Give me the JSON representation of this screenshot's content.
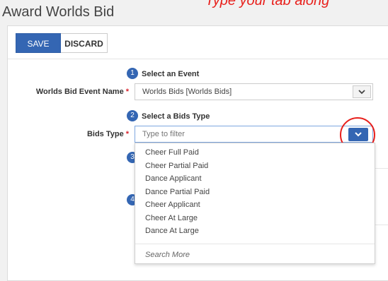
{
  "annotation": {
    "top_text": "Type your tab along"
  },
  "page": {
    "title": "Award Worlds Bid"
  },
  "toolbar": {
    "save_label": "SAVE",
    "discard_label": "DISCARD"
  },
  "steps": [
    {
      "number": "1",
      "title": "Select an Event"
    },
    {
      "number": "2",
      "title": "Select a Bids Type"
    },
    {
      "number": "3"
    },
    {
      "number": "4"
    }
  ],
  "event_field": {
    "label": "Worlds Bid Event Name",
    "required_mark": "*",
    "value": "Worlds Bids [Worlds Bids]"
  },
  "bids_type_field": {
    "label": "Bids Type",
    "required_mark": "*",
    "placeholder": "Type to filter"
  },
  "dropdown": {
    "options": [
      "Cheer Full Paid",
      "Cheer Partial Paid",
      "Dance Applicant",
      "Dance Partial Paid",
      "Cheer Applicant",
      "Cheer At Large",
      "Dance At Large"
    ],
    "search_more": "Search More"
  },
  "colors": {
    "primary": "#3466b3",
    "annotation_red": "#e8201c",
    "required": "#d9232d"
  }
}
